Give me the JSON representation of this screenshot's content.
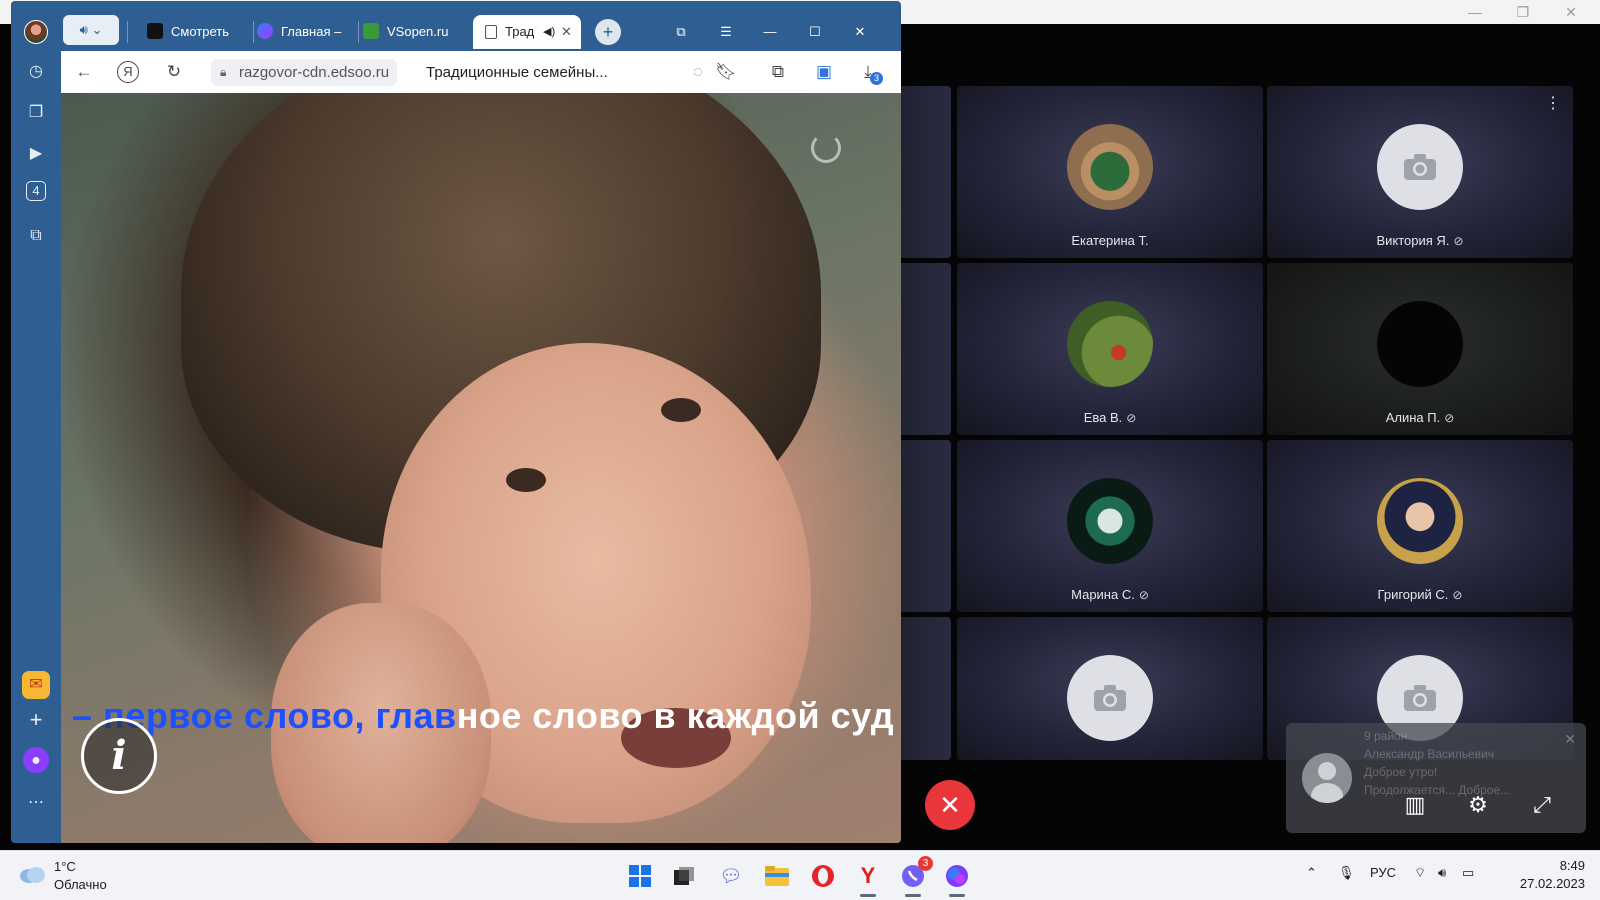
{
  "meeting": {
    "participants": [
      {
        "name": "Екатерина Т.",
        "muted": false
      },
      {
        "name": "Виктория Я.",
        "muted": true
      },
      {
        "name": "Ева В.",
        "muted": true
      },
      {
        "name": "Алина П.",
        "muted": true
      },
      {
        "name": "Марина С.",
        "muted": true
      },
      {
        "name": "Григорий С.",
        "muted": true
      }
    ],
    "notification": {
      "title": "9 район",
      "sender": "Александр Васильевич",
      "line1": "Доброе утро!",
      "line2": "Продолжается... Доброе..."
    },
    "mic_off_icon": "🎙̸",
    "more_icon": "⋮"
  },
  "browser": {
    "tabs": [
      {
        "label": "Смотреть",
        "icon": "video-play-icon",
        "color": "#111111"
      },
      {
        "label": "Главная –",
        "icon": "alice-icon",
        "color": "#7b3cff"
      },
      {
        "label": "VSopen.ru",
        "icon": "vsopen-icon",
        "color": "#3a9a3a"
      },
      {
        "label": "Трад",
        "icon": "page-icon",
        "color": "#ffffff"
      }
    ],
    "url": "razgovor-cdn.edsoo.ru",
    "page_title": "Традиционные семейны...",
    "downloads_count": "3",
    "sidebar_badge": "4",
    "subtitle_sung": "а – первое слово, глав",
    "subtitle_unsung": "ное слово в каждой суд",
    "info_glyph": "i"
  },
  "taskbar": {
    "weather_temp": "1°C",
    "weather_desc": "Облачно",
    "lang": "РУС",
    "time": "8:49",
    "date": "27.02.2023",
    "viber_badge": "3"
  }
}
